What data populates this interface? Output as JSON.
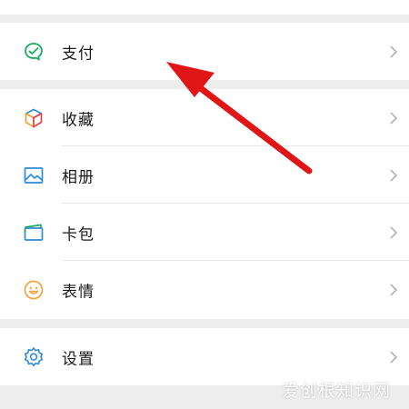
{
  "menu": {
    "pay": {
      "label": "支付",
      "icon": "wechat-pay-icon"
    },
    "collect": {
      "label": "收藏",
      "icon": "cube-icon"
    },
    "album": {
      "label": "相册",
      "icon": "image-icon"
    },
    "card": {
      "label": "卡包",
      "icon": "wallet-icon"
    },
    "sticker": {
      "label": "表情",
      "icon": "smiley-icon"
    },
    "settings": {
      "label": "设置",
      "icon": "gear-icon"
    }
  },
  "annotation": {
    "arrow_color": "#e01515"
  },
  "watermark": {
    "text": "爱创根知识网"
  },
  "colors": {
    "background": "#ededed",
    "card": "#ffffff",
    "pay_green": "#1aad5e",
    "blue": "#2e8bd6",
    "orange": "#f3a33a"
  }
}
